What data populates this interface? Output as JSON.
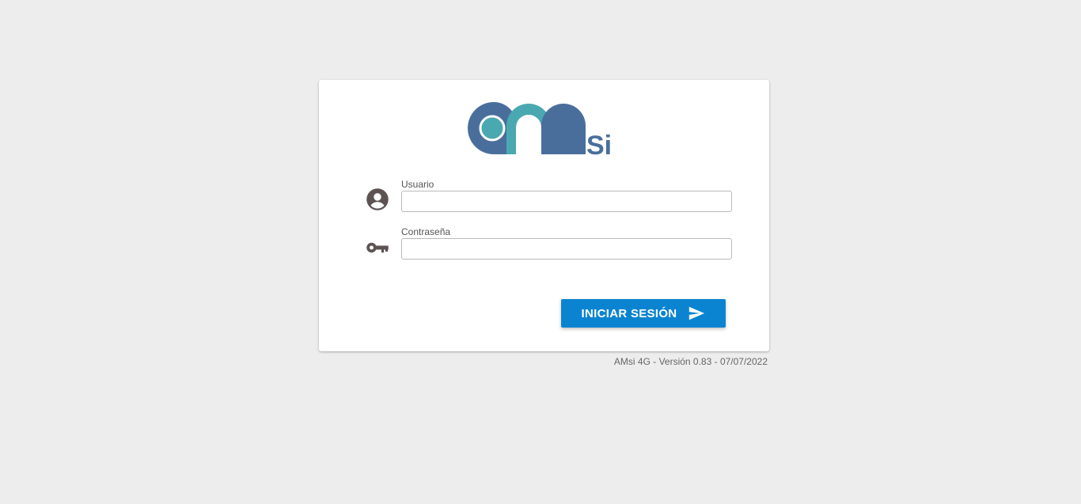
{
  "brand": {
    "logo_letters": "AMSi",
    "logo_colors": {
      "dark": "#4a6e9c",
      "teal": "#4aa8b0"
    }
  },
  "form": {
    "username": {
      "label": "Usuario",
      "value": "",
      "placeholder": "",
      "icon": "user-circle-icon"
    },
    "password": {
      "label": "Contraseña",
      "value": "",
      "placeholder": "",
      "icon": "key-icon"
    },
    "submit": {
      "label": "INICIAR SESIÓN",
      "icon": "send-icon",
      "color": "#0a84d0"
    }
  },
  "footer": {
    "version": "AMsi 4G - Versión 0.83 - 07/07/2022"
  }
}
